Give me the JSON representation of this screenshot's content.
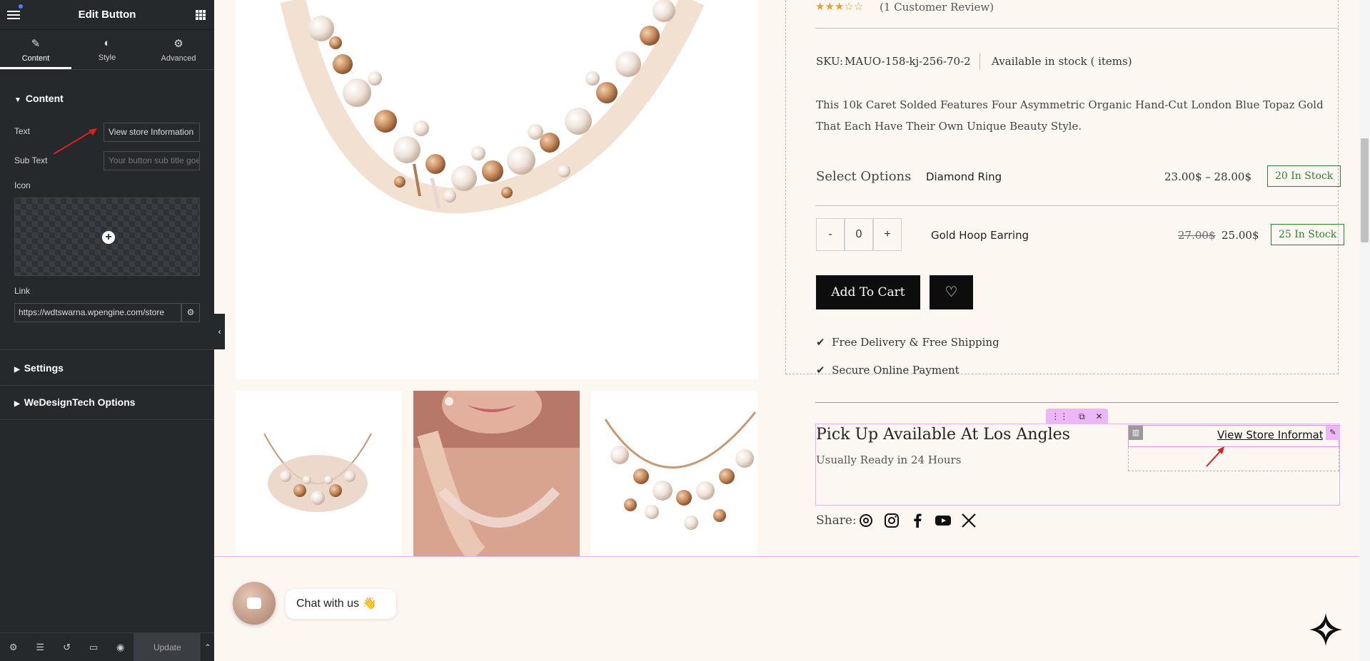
{
  "editor": {
    "title": "Edit Button",
    "tabs": [
      {
        "label": "Content",
        "icon": "pencil-icon"
      },
      {
        "label": "Style",
        "icon": "half-circle-icon"
      },
      {
        "label": "Advanced",
        "icon": "gear-icon"
      }
    ],
    "content_section": "Content",
    "text_label": "Text",
    "text_value": "View store Information",
    "subtext_label": "Sub Text",
    "subtext_placeholder": "Your button sub title goes here",
    "icon_label": "Icon",
    "link_label": "Link",
    "link_value": "https://wdtswarna.wpengine.com/store",
    "settings_section": "Settings",
    "wedesigntech_section": "WeDesignTech Options",
    "footer": {
      "update_label": "Update"
    }
  },
  "product": {
    "review": "(1 Customer Review)",
    "sku_label": "SKU:",
    "sku_value": "MAUO-158-kj-256-70-2",
    "availability": "Available in stock ( items)",
    "description": "This 10k Caret Solded Features Four Asymmetric Organic Hand-Cut London Blue Topaz Gold That Each Have Their Own Unique Beauty Style.",
    "select_label": "Select Options",
    "options": [
      {
        "name": "Diamond Ring",
        "price": "23.00$ – 28.00$",
        "old_price": "",
        "stock": "20 In Stock"
      },
      {
        "name": "Gold Hoop Earring",
        "price": "25.00$",
        "old_price": "27.00$",
        "stock": "25 In Stock"
      }
    ],
    "qty": {
      "minus": "-",
      "value": "0",
      "plus": "+"
    },
    "add_to_cart": "Add To Cart",
    "features": [
      "Free Delivery & Free Shipping",
      "Secure Online Payment"
    ],
    "pickup_title": "Pick Up Available At Los Angles",
    "pickup_sub": "Usually Ready in 24 Hours",
    "store_button": "View Store Information",
    "share_label": "Share:",
    "social_icons": [
      "threads-icon",
      "instagram-icon",
      "facebook-icon",
      "youtube-icon",
      "x-icon"
    ]
  },
  "chat": {
    "label": "Chat with us 👋"
  },
  "colors": {
    "stock_green": "#2e7d32",
    "editor_bg": "#26292c",
    "accent_pink": "#e5b3ef",
    "rating": "#e0a23b"
  }
}
